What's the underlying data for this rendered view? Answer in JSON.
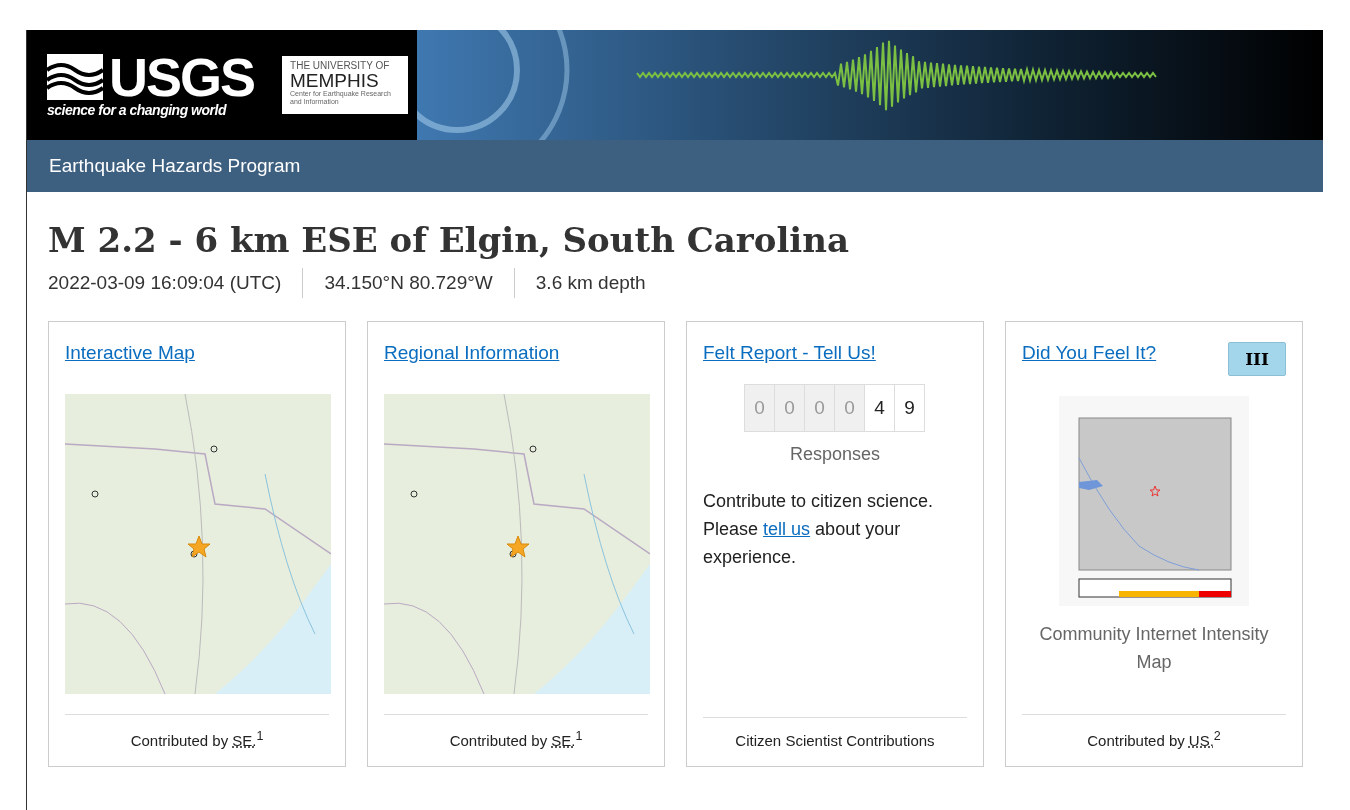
{
  "header": {
    "logo_text": "USGS",
    "tagline": "science for a changing world",
    "partner": {
      "line1": "THE UNIVERSITY OF",
      "line2": "MEMPHIS",
      "line3": "Center for Earthquake Research and Information"
    }
  },
  "nav": {
    "title": "Earthquake Hazards Program"
  },
  "event": {
    "title": "M 2.2 - 6 km ESE of Elgin, South Carolina",
    "details": [
      "2022-03-09 16:09:04 (UTC)",
      "34.150°N 80.729°W",
      "3.6 km depth"
    ]
  },
  "cards": [
    {
      "kind": "map",
      "title": "Interactive Map",
      "footer": {
        "prefix": "Contributed by",
        "source": "SE.",
        "note": "1"
      }
    },
    {
      "kind": "map",
      "title": "Regional Information",
      "footer": {
        "prefix": "Contributed by",
        "source": "SE.",
        "note": "1"
      }
    },
    {
      "kind": "counter",
      "title": "Felt Report - Tell Us!",
      "digits": [
        {
          "digit": "0",
          "dimmed": true
        },
        {
          "digit": "0",
          "dimmed": true
        },
        {
          "digit": "0",
          "dimmed": true
        },
        {
          "digit": "0",
          "dimmed": true
        },
        {
          "digit": "4",
          "dimmed": false
        },
        {
          "digit": "9",
          "dimmed": false
        }
      ],
      "counter_label": "Responses",
      "text_before": "Contribute to citizen science. Please",
      "link": "tell us",
      "text_after": "about your experience.",
      "footer": {
        "prefix": "Citizen Scientist Contributions"
      }
    },
    {
      "kind": "intensity",
      "title": "Did You Feel It?",
      "badge": "III",
      "caption": "Community Internet Intensity Map",
      "footer": {
        "prefix": "Contributed by",
        "source": "US.",
        "note": "2"
      }
    }
  ]
}
